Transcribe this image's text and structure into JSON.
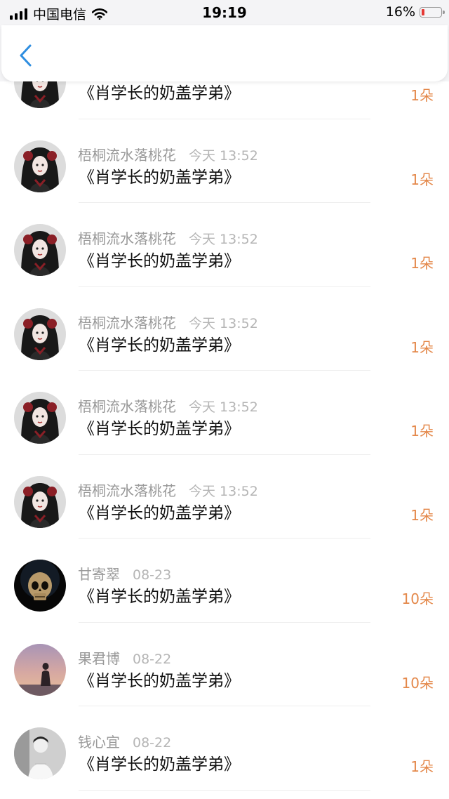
{
  "status_bar": {
    "carrier": "中国电信",
    "time": "19:19",
    "battery": "16%"
  },
  "nav": {
    "back_label": "back"
  },
  "list": [
    {
      "user": "",
      "time": "",
      "book": "《肖学长的奶盖学弟》",
      "amount": "1朵",
      "avatar": "girl"
    },
    {
      "user": "梧桐流水落桃花",
      "time": "今天 13:52",
      "book": "《肖学长的奶盖学弟》",
      "amount": "1朵",
      "avatar": "girl"
    },
    {
      "user": "梧桐流水落桃花",
      "time": "今天 13:52",
      "book": "《肖学长的奶盖学弟》",
      "amount": "1朵",
      "avatar": "girl"
    },
    {
      "user": "梧桐流水落桃花",
      "time": "今天 13:52",
      "book": "《肖学长的奶盖学弟》",
      "amount": "1朵",
      "avatar": "girl"
    },
    {
      "user": "梧桐流水落桃花",
      "time": "今天 13:52",
      "book": "《肖学长的奶盖学弟》",
      "amount": "1朵",
      "avatar": "girl"
    },
    {
      "user": "梧桐流水落桃花",
      "time": "今天 13:52",
      "book": "《肖学长的奶盖学弟》",
      "amount": "1朵",
      "avatar": "girl"
    },
    {
      "user": "甘寄翠",
      "time": "08-23",
      "book": "《肖学长的奶盖学弟》",
      "amount": "10朵",
      "avatar": "skull"
    },
    {
      "user": "果君博",
      "time": "08-22",
      "book": "《肖学长的奶盖学弟》",
      "amount": "10朵",
      "avatar": "sunset"
    },
    {
      "user": "钱心宜",
      "time": "08-22",
      "book": "《肖学长的奶盖学弟》",
      "amount": "1朵",
      "avatar": "bw"
    }
  ]
}
